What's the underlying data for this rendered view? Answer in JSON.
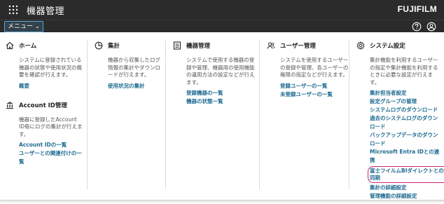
{
  "header": {
    "title": "機器管理",
    "brand": "FUJIFILM"
  },
  "menubar": {
    "menu_label": "メニュー"
  },
  "sections": {
    "home": {
      "title": "ホーム",
      "desc": "システムに登録されている機器の状態や使用状況の概要を確認が行えます。",
      "links": [
        "概要"
      ]
    },
    "account": {
      "title": "Account ID管理",
      "desc": "機器に登録したAccount ID毎にログの集計が行えます。",
      "links": [
        "Account IDの一覧",
        "ユーザーとの関連付けの一覧"
      ]
    },
    "aggregate": {
      "title": "集計",
      "desc": "機器から収集したログ情報の集計やダウンロードが行えます。",
      "links": [
        "使用状況の集計"
      ]
    },
    "device": {
      "title": "機器管理",
      "desc": "システムで使用する機器の登録や管理、機器用の使用機能の運用方法の設定などが行えます。",
      "links": [
        "登録機器の一覧",
        "機器の状態一覧"
      ]
    },
    "user": {
      "title": "ユーザー管理",
      "desc": "システムを使用するユーザーの登録や管理、各ユーザーの権限の指定などが行えます。",
      "links": [
        "登録ユーザーの一覧",
        "未登録ユーザーの一覧"
      ]
    },
    "system": {
      "title": "システム設定",
      "desc": "集計機能を利用するユーザーの指定や集計機能を利用するときに必要な設定が行えます。",
      "links": [
        "集計担当者設定",
        "設定グループの管理",
        "システムログのダウンロード",
        "過去のシステムログのダウンロード",
        "バックアップデータのダウンロード",
        "Microsoft Entra IDとの連携"
      ],
      "highlighted_link": "富士フイルムBIダイレクトとの同期",
      "links_after": [
        "集計の詳細設定",
        "管理機能の詳細設定"
      ]
    }
  }
}
